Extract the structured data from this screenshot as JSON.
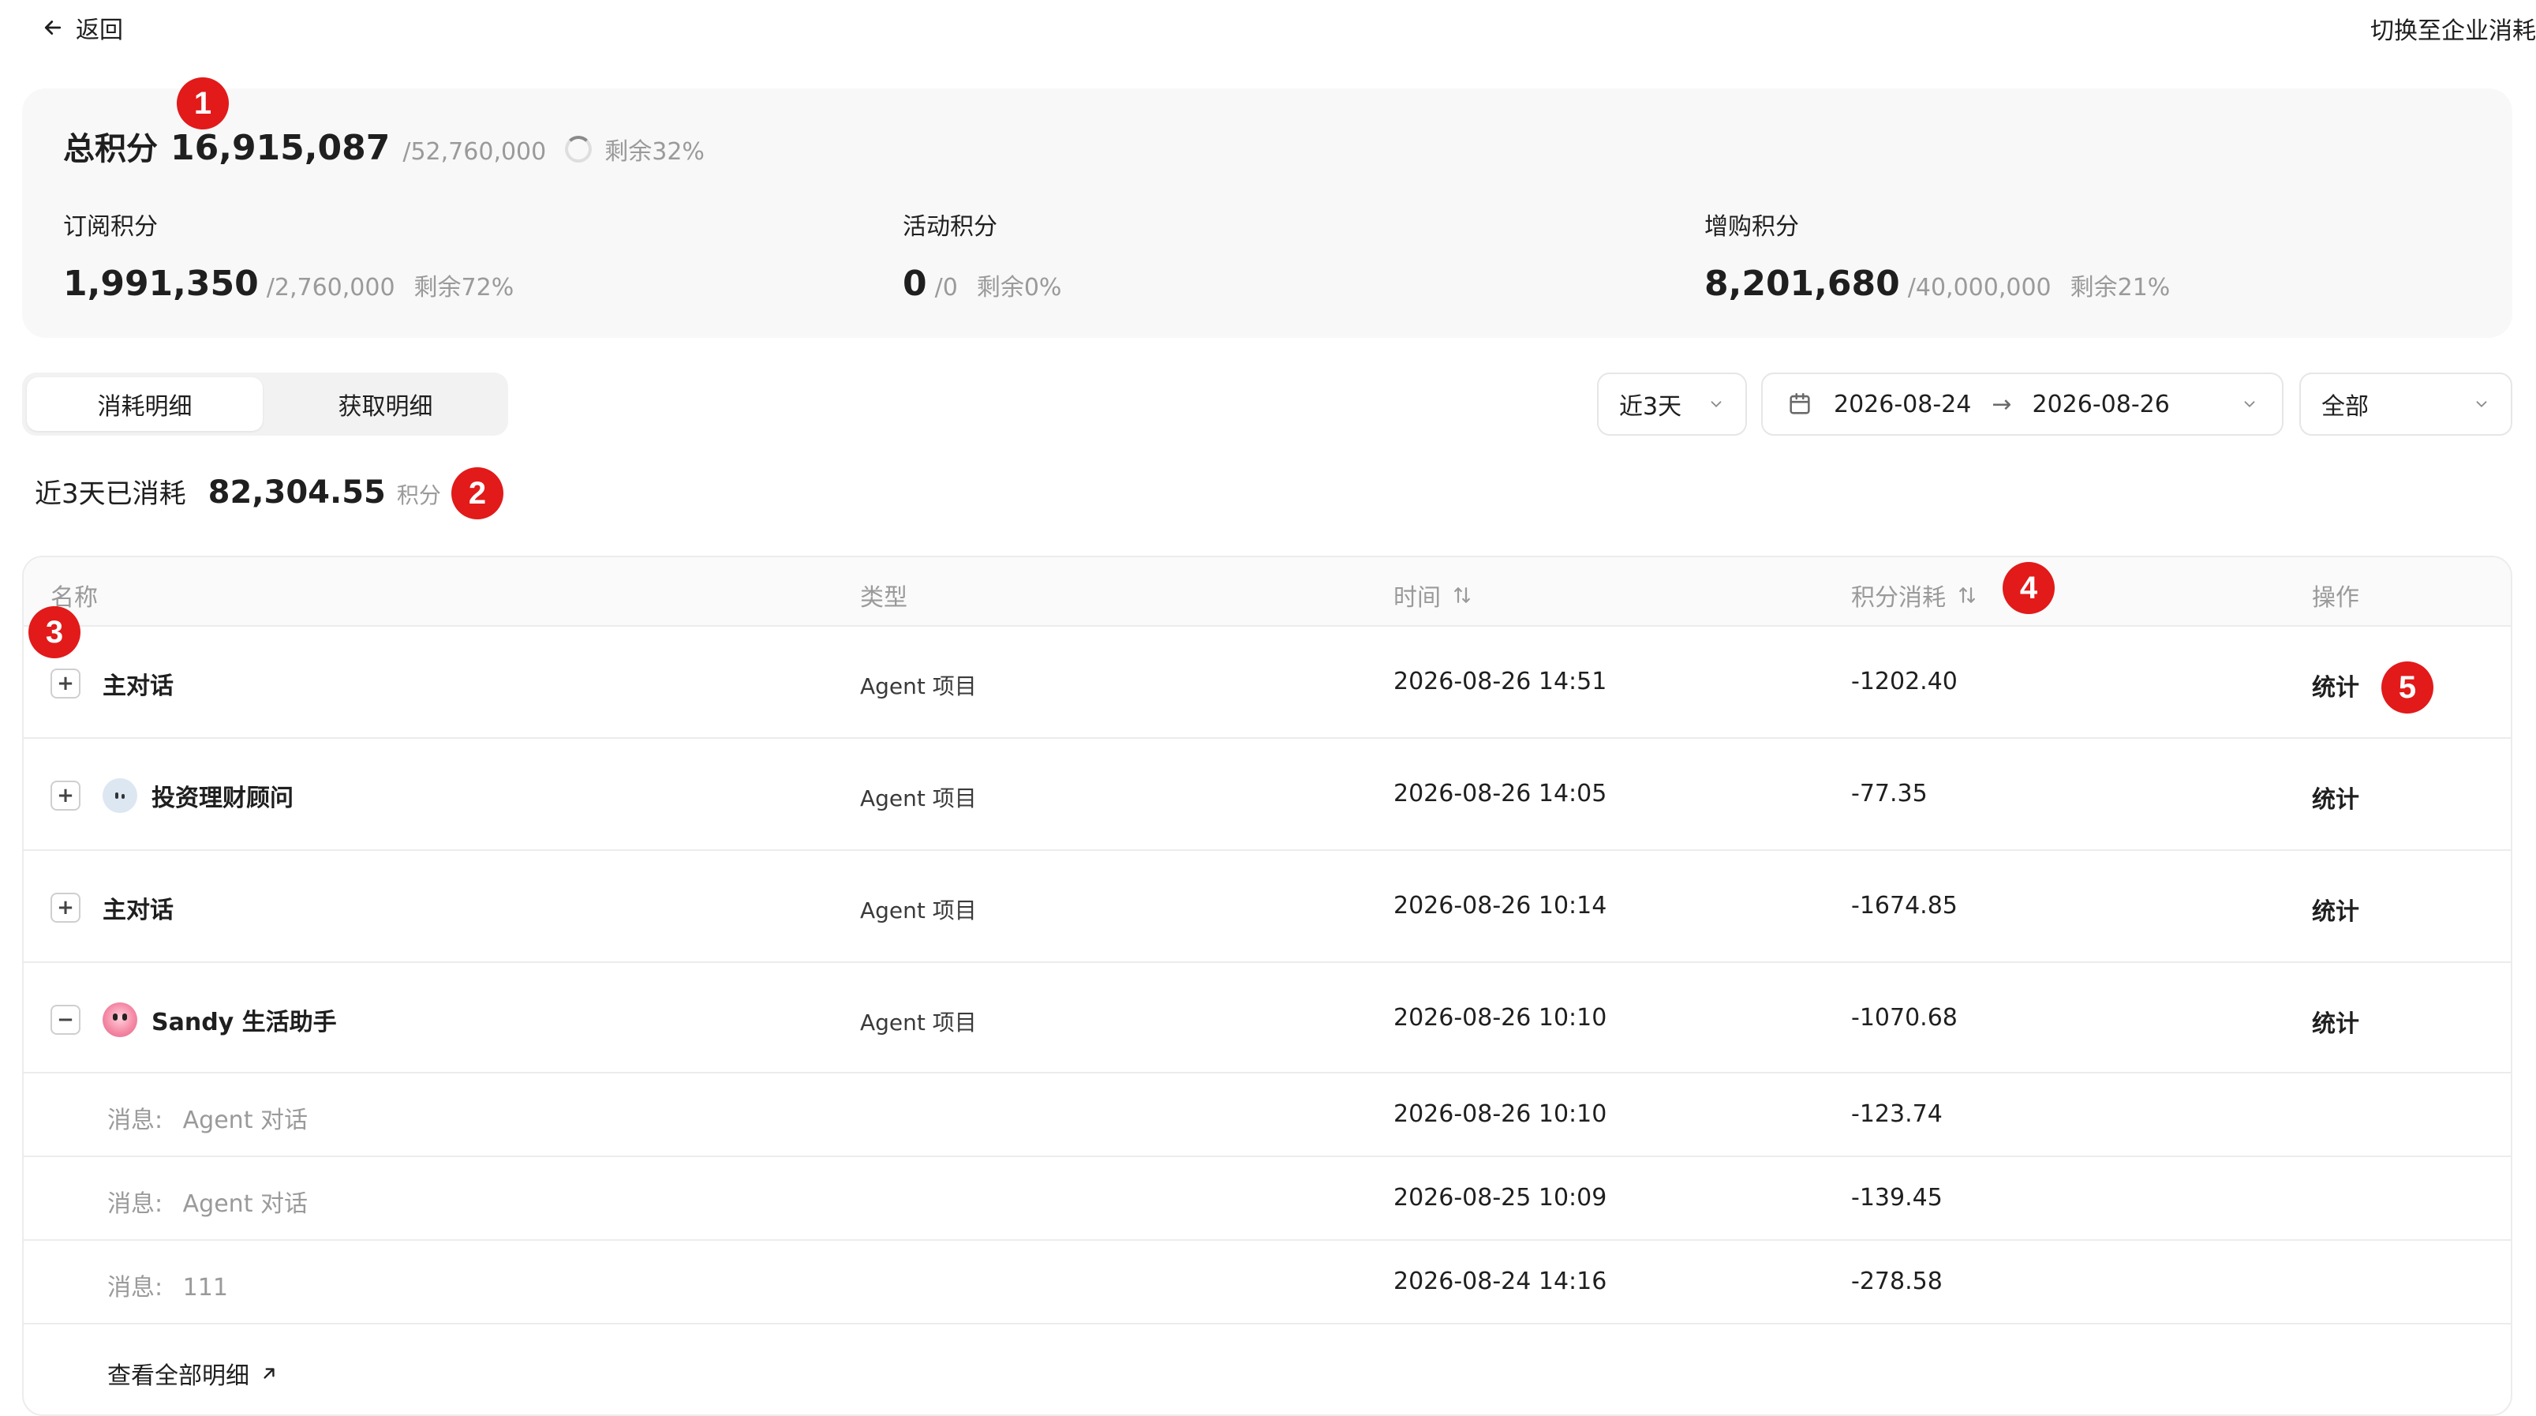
{
  "header": {
    "back_label": "返回",
    "switch_label": "切换至企业消耗"
  },
  "summary": {
    "total": {
      "label": "总积分",
      "value": "16,915,087",
      "quota": "/52,760,000",
      "remaining": "剩余32%"
    },
    "subscription": {
      "label": "订阅积分",
      "value": "1,991,350",
      "quota": "/2,760,000",
      "remaining": "剩余72%"
    },
    "activity": {
      "label": "活动积分",
      "value": "0",
      "quota": "/0",
      "remaining": "剩余0%"
    },
    "purchase": {
      "label": "增购积分",
      "value": "8,201,680",
      "quota": "/40,000,000",
      "remaining": "剩余21%"
    }
  },
  "tabs": [
    {
      "label": "消耗明细",
      "active": true
    },
    {
      "label": "获取明细",
      "active": false
    }
  ],
  "filters": {
    "range": "近3天",
    "date_start": "2026-08-24",
    "date_end": "2026-08-26",
    "arrow": "→",
    "category": "全部"
  },
  "spent": {
    "label": "近3天已消耗",
    "value": "82,304.55",
    "unit": "积分"
  },
  "table": {
    "headers": {
      "name": "名称",
      "type": "类型",
      "time": "时间",
      "points": "积分消耗",
      "action": "操作"
    },
    "rows": [
      {
        "name": "主对话",
        "type": "Agent 项目",
        "time": "2026-08-26 14:51",
        "points": "-1202.40",
        "action": "统计",
        "expander": "+"
      },
      {
        "name": "投资理财顾问",
        "type": "Agent 项目",
        "time": "2026-08-26 14:05",
        "points": "-77.35",
        "action": "统计",
        "expander": "+"
      },
      {
        "name": "主对话",
        "type": "Agent 项目",
        "time": "2026-08-26 10:14",
        "points": "-1674.85",
        "action": "统计",
        "expander": "+"
      },
      {
        "name": "Sandy 生活助手",
        "type": "Agent 项目",
        "time": "2026-08-26 10:10",
        "points": "-1070.68",
        "action": "统计",
        "expander": "−"
      }
    ],
    "sub_rows": [
      {
        "label": "消息:",
        "value": "Agent 对话",
        "time": "2026-08-26 10:10",
        "points": "-123.74"
      },
      {
        "label": "消息:",
        "value": "Agent 对话",
        "time": "2026-08-25 10:09",
        "points": "-139.45"
      },
      {
        "label": "消息:",
        "value": "111",
        "time": "2026-08-24 14:16",
        "points": "-278.58"
      }
    ],
    "view_all": "查看全部明细"
  },
  "badges": [
    "1",
    "2",
    "3",
    "4",
    "5"
  ],
  "colors": {
    "badge": "#e21a1a",
    "muted": "#9a9a9a",
    "panel": "#f8f8f8"
  }
}
